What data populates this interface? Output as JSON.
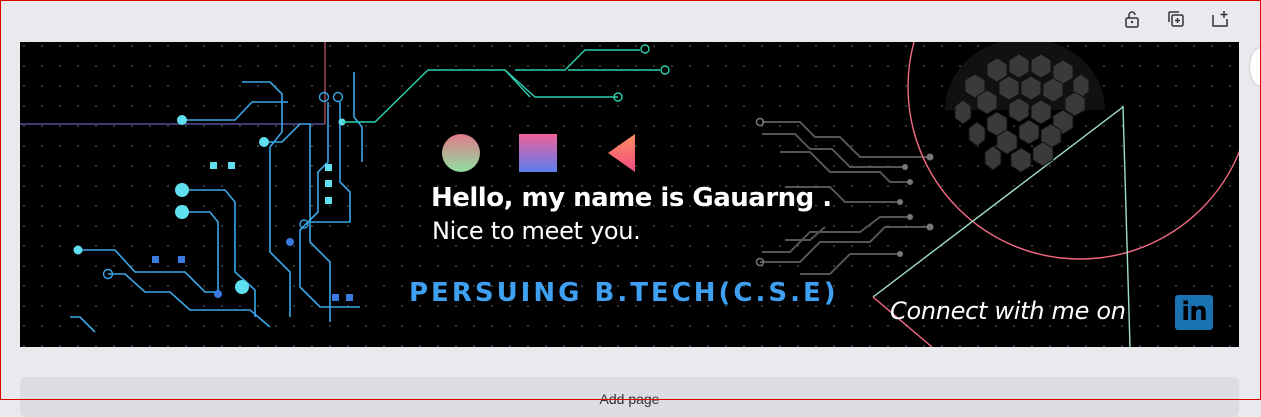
{
  "toolbar": {
    "lock": {
      "icon": "lock-icon"
    },
    "duplicate": {
      "icon": "duplicate-icon"
    },
    "add_page": {
      "icon": "add-page-icon"
    }
  },
  "banner": {
    "greeting": "Hello, my name is Gauarng .",
    "subtitle": "Nice to meet you.",
    "course": "PERSUING B.TECH(C.S.E)",
    "connect": "Connect with me on",
    "linkedin_text": "in"
  },
  "bottom_panel": {
    "label": "Add page"
  },
  "colors": {
    "canvas_bg": "#000000",
    "course_text": "#3f9ff0",
    "circuit_blue": "#3aa8e8",
    "circuit_cyan": "#5fe0f0",
    "circuit_teal": "#2ecfb0",
    "accent_pink": "#f06a80",
    "triangle_green": "#9fe0c0",
    "linkedin_blue": "#1a73b0"
  }
}
